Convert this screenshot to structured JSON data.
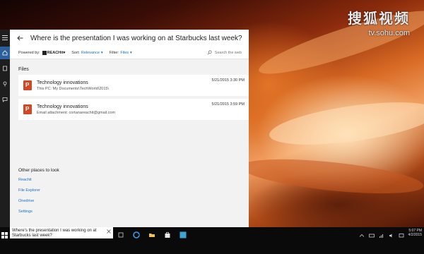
{
  "watermark": {
    "brand": "搜狐视频",
    "url": "tv.sohu.com"
  },
  "cortana": {
    "query": "Where is the presentation I was working on at Starbucks last week?",
    "filters": {
      "powered_by_label": "Powered by:",
      "powered_by_brand": "REACHit",
      "sort_label": "Sort:",
      "sort_value": "Relevance",
      "filter_label": "Filter:",
      "filter_value": "Files",
      "search_web": "Search the web"
    },
    "files_heading": "Files",
    "files": [
      {
        "title": "Technology innovations",
        "detail": "This PC: My Documents\\TechWorld\\2015\\",
        "date": "5/21/2015 3:30 PM"
      },
      {
        "title": "Technology innovations",
        "detail": "Email attachment: cortanareachit@gmail.com",
        "date": "5/21/2015 3:59 PM"
      }
    ],
    "other_places": {
      "heading": "Other places to look",
      "links": [
        "Reachit",
        "File Explorer",
        "Onedrive",
        "Settings"
      ]
    }
  },
  "taskbar": {
    "search_text": "Where's the presentation I was working on at Starbucks last week?",
    "clock_time": "5:07 PM",
    "clock_date": "4/2/2015"
  }
}
